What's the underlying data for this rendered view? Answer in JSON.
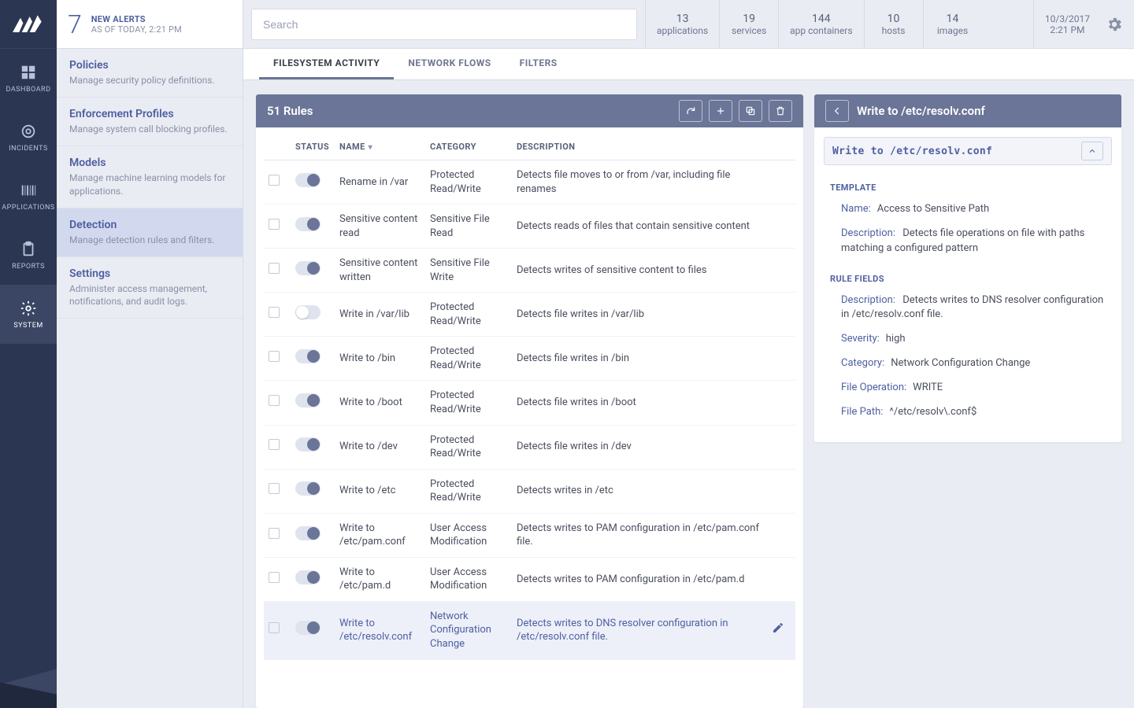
{
  "rail": {
    "items": [
      {
        "label": "DASHBOARD"
      },
      {
        "label": "INCIDENTS"
      },
      {
        "label": "APPLICATIONS"
      },
      {
        "label": "REPORTS"
      },
      {
        "label": "SYSTEM"
      }
    ]
  },
  "alerts": {
    "count": "7",
    "title": "NEW ALERTS",
    "subtitle": "AS OF TODAY, 2:21 PM"
  },
  "sidebar": [
    {
      "title": "Policies",
      "sub": "Manage security policy definitions."
    },
    {
      "title": "Enforcement Profiles",
      "sub": "Manage system call blocking profiles."
    },
    {
      "title": "Models",
      "sub": "Manage machine learning models for applications."
    },
    {
      "title": "Detection",
      "sub": "Manage detection rules and filters."
    },
    {
      "title": "Settings",
      "sub": "Administer access management, notifications, and audit logs."
    }
  ],
  "topbar": {
    "search_placeholder": "Search",
    "stats": [
      {
        "value": "13",
        "label": "applications"
      },
      {
        "value": "19",
        "label": "services"
      },
      {
        "value": "144",
        "label": "app containers"
      },
      {
        "value": "10",
        "label": "hosts"
      },
      {
        "value": "14",
        "label": "images"
      }
    ],
    "date": "10/3/2017",
    "time": "2:21 PM"
  },
  "tabs": [
    {
      "label": "FILESYSTEM ACTIVITY"
    },
    {
      "label": "NETWORK FLOWS"
    },
    {
      "label": "FILTERS"
    }
  ],
  "rules_header": "51 Rules",
  "columns": {
    "status": "STATUS",
    "name": "NAME",
    "category": "CATEGORY",
    "description": "DESCRIPTION"
  },
  "rows": [
    {
      "on": true,
      "name": "Rename in /var",
      "category": "Protected Read/Write",
      "desc": "Detects file moves to or from /var, including file renames"
    },
    {
      "on": true,
      "name": "Sensitive content read",
      "category": "Sensitive File Read",
      "desc": "Detects reads of files that contain sensitive content"
    },
    {
      "on": true,
      "name": "Sensitive content written",
      "category": "Sensitive File Write",
      "desc": "Detects writes of sensitive content to files"
    },
    {
      "on": false,
      "name": "Write in /var/lib",
      "category": "Protected Read/Write",
      "desc": "Detects file writes in /var/lib"
    },
    {
      "on": true,
      "name": "Write to /bin",
      "category": "Protected Read/Write",
      "desc": "Detects file writes in /bin"
    },
    {
      "on": true,
      "name": "Write to /boot",
      "category": "Protected Read/Write",
      "desc": "Detects file writes in /boot"
    },
    {
      "on": true,
      "name": "Write to /dev",
      "category": "Protected Read/Write",
      "desc": "Detects file writes in /dev"
    },
    {
      "on": true,
      "name": "Write to /etc",
      "category": "Protected Read/Write",
      "desc": "Detects writes in /etc"
    },
    {
      "on": true,
      "name": "Write to /etc/pam.conf",
      "category": "User Access Modification",
      "desc": "Detects writes to PAM configuration in /etc/pam.conf file."
    },
    {
      "on": true,
      "name": "Write to /etc/pam.d",
      "category": "User Access Modification",
      "desc": "Detects writes to PAM configuration in /etc/pam.d"
    },
    {
      "on": true,
      "name": "Write to /etc/resolv.conf",
      "category": "Network Configuration Change",
      "desc": "Detects writes to DNS resolver configuration in /etc/resolv.conf file."
    }
  ],
  "detail": {
    "header": "Write to /etc/resolv.conf",
    "accordion_label": "Write to /etc/resolv.conf",
    "template_title": "TEMPLATE",
    "template": {
      "name_k": "Name:",
      "name_v": "Access to Sensitive Path",
      "desc_k": "Description:",
      "desc_v": "Detects file operations on file with paths matching a configured pattern"
    },
    "fields_title": "RULE FIELDS",
    "fields": {
      "desc_k": "Description:",
      "desc_v": "Detects writes to DNS resolver configuration in /etc/resolv.conf file.",
      "sev_k": "Severity:",
      "sev_v": "high",
      "cat_k": "Category:",
      "cat_v": "Network Configuration Change",
      "op_k": "File Operation:",
      "op_v": "WRITE",
      "path_k": "File Path:",
      "path_v": "^/etc/resolv\\.conf$"
    }
  }
}
